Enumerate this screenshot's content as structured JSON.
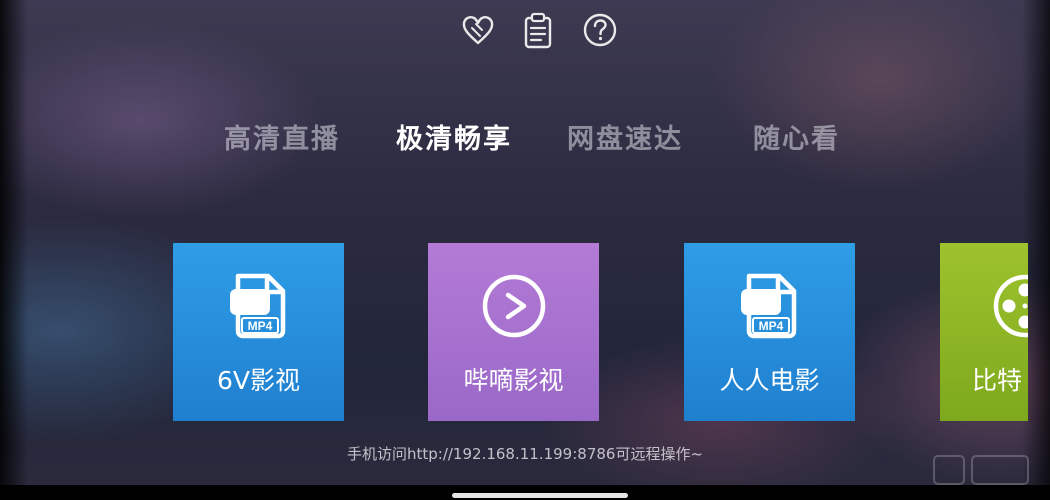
{
  "top_icons": [
    {
      "name": "favorites-heart-icon"
    },
    {
      "name": "clipboard-icon"
    },
    {
      "name": "help-icon"
    }
  ],
  "tabs": [
    {
      "label": "高清直播",
      "active": false
    },
    {
      "label": "极清畅享",
      "active": true
    },
    {
      "label": "网盘速达",
      "active": false
    },
    {
      "label": "随心看",
      "active": false
    }
  ],
  "tiles": [
    {
      "label": "6V影视",
      "icon": "mp4-file-icon",
      "color_start": "#2f9de6",
      "color_end": "#1f7fcf"
    },
    {
      "label": "哔嘀影视",
      "icon": "play-circle-icon",
      "color_start": "#b47ad6",
      "color_end": "#9a68c8"
    },
    {
      "label": "人人电影",
      "icon": "mp4-file-icon",
      "color_start": "#2f9de6",
      "color_end": "#1f7fcf"
    },
    {
      "label": "比特",
      "icon": "film-reel-icon",
      "color_start": "#9dc22d",
      "color_end": "#7ea91d"
    }
  ],
  "hint": "手机访问http://192.168.11.199:8786可远程操作~"
}
